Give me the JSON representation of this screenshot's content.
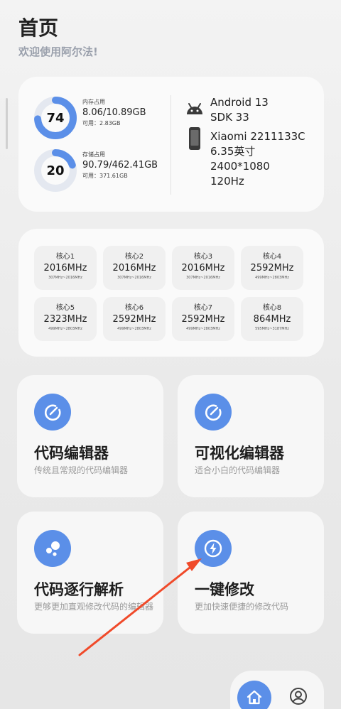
{
  "header": {
    "title": "首页",
    "subtitle": "欢迎使用阿尔法!"
  },
  "memory": {
    "percent": 74,
    "label": "内存占用",
    "usage": "8.06/10.89GB",
    "available": "可用：2.83GB"
  },
  "storage": {
    "percent": 20,
    "label": "存储占用",
    "usage": "90.79/462.41GB",
    "available": "可用：371.61GB"
  },
  "device": {
    "android": "Android 13",
    "sdk": "SDK 33",
    "model": "Xiaomi 2211133C",
    "screen_size": "6.35英寸",
    "resolution": "2400*1080",
    "refresh": "120Hz"
  },
  "cores": [
    {
      "name": "核心1",
      "freq": "2016MHz",
      "range": "307MHz~2016MHz"
    },
    {
      "name": "核心2",
      "freq": "2016MHz",
      "range": "307MHz~2016MHz"
    },
    {
      "name": "核心3",
      "freq": "2016MHz",
      "range": "307MHz~2016MHz"
    },
    {
      "name": "核心4",
      "freq": "2592MHz",
      "range": "499MHz~2803MHz"
    },
    {
      "name": "核心5",
      "freq": "2323MHz",
      "range": "499MHz~2803MHz"
    },
    {
      "name": "核心6",
      "freq": "2592MHz",
      "range": "499MHz~2803MHz"
    },
    {
      "name": "核心7",
      "freq": "2592MHz",
      "range": "499MHz~2803MHz"
    },
    {
      "name": "核心8",
      "freq": "864MHz",
      "range": "595MHz~3187MHz"
    }
  ],
  "tiles": [
    {
      "title": "代码编辑器",
      "desc": "传统且常规的代码编辑器",
      "icon": "edit-icon"
    },
    {
      "title": "可视化编辑器",
      "desc": "适合小白的代码编辑器",
      "icon": "edit-icon"
    },
    {
      "title": "代码逐行解析",
      "desc": "更够更加直观修改代码的编辑器",
      "icon": "bubbles-icon"
    },
    {
      "title": "一键修改",
      "desc": "更加快速便捷的修改代码",
      "icon": "lightning-icon"
    }
  ],
  "colors": {
    "accent": "#5b8fe8",
    "gauge_track": "#e4e8f0",
    "arrow": "#f04a2a"
  },
  "nav": {
    "home_icon": "home-icon",
    "profile_icon": "user-icon"
  }
}
